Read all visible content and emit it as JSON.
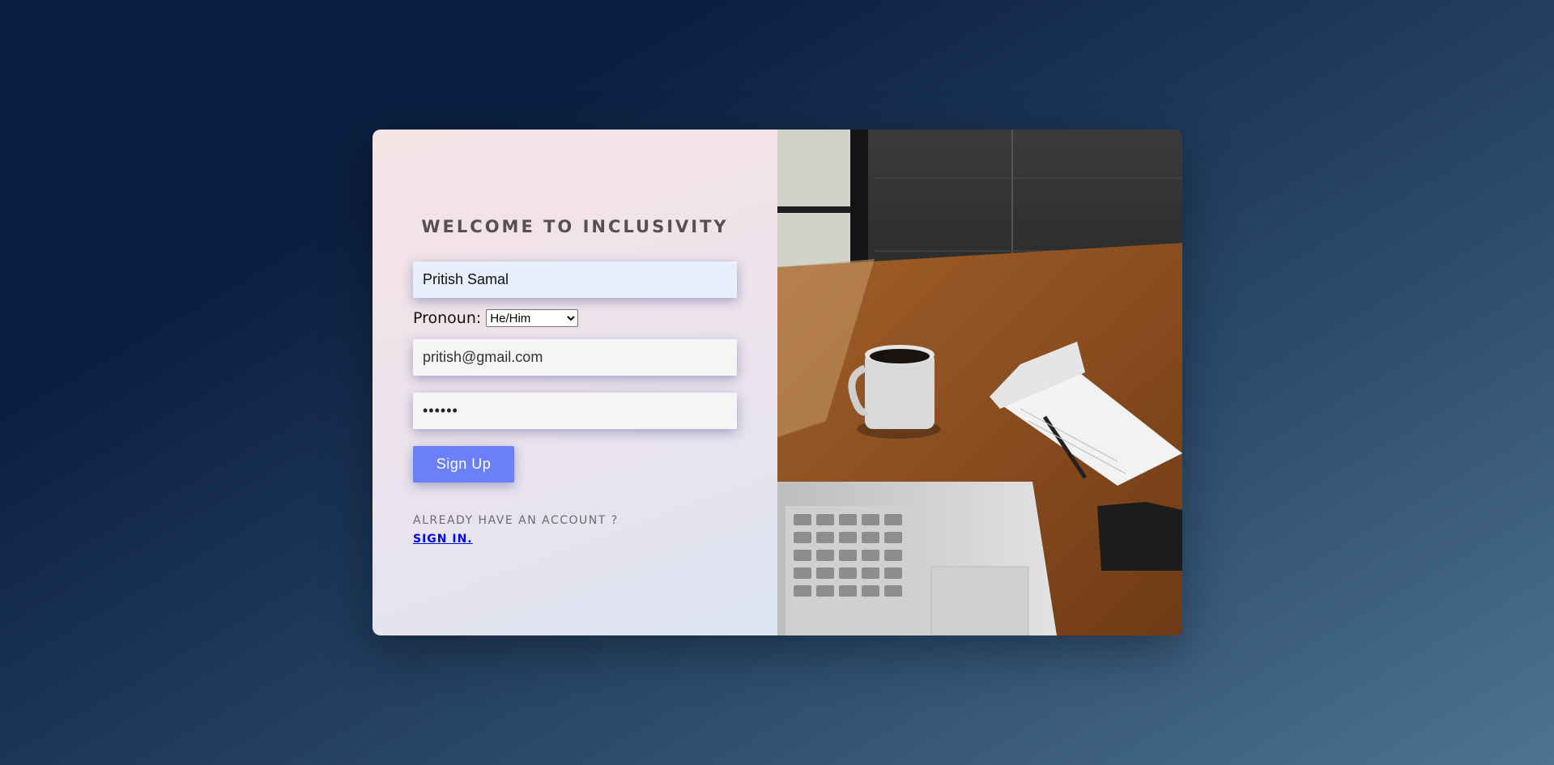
{
  "form": {
    "title": "WELCOME TO INCLUSIVITY",
    "name_value": "Pritish Samal",
    "pronoun_label": "Pronoun:",
    "pronoun_selected": "He/Him",
    "email_value": "pritish@gmail.com",
    "password_mask": "••••••",
    "signup_label": "Sign Up",
    "account_prompt": "ALREADY HAVE AN ACCOUNT ?",
    "signin_label": "SIGN IN."
  },
  "image": {
    "icon": "desk-photo"
  },
  "colors": {
    "button": "#6b7ff8",
    "link": "#0000ee",
    "title": "#585050"
  }
}
